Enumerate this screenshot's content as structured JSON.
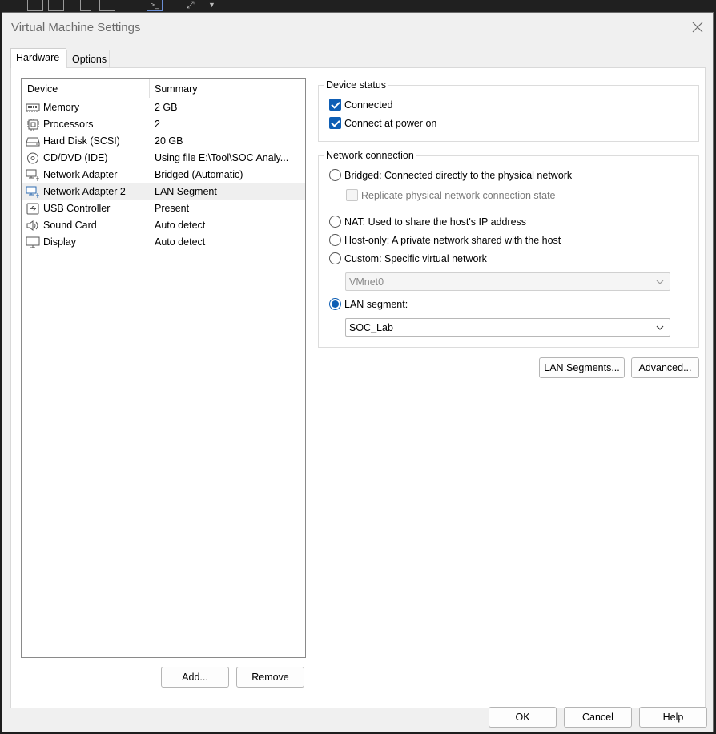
{
  "dialog": {
    "title": "Virtual Machine Settings"
  },
  "tabs": [
    {
      "label": "Hardware",
      "active": true
    },
    {
      "label": "Options",
      "active": false
    }
  ],
  "device_list": {
    "columns": [
      "Device",
      "Summary"
    ],
    "rows": [
      {
        "icon": "memory-icon",
        "name": "Memory",
        "summary": "2 GB"
      },
      {
        "icon": "processor-icon",
        "name": "Processors",
        "summary": "2"
      },
      {
        "icon": "hard-disk-icon",
        "name": "Hard Disk (SCSI)",
        "summary": "20 GB"
      },
      {
        "icon": "cd-dvd-icon",
        "name": "CD/DVD (IDE)",
        "summary": "Using file E:\\Tool\\SOC Analy..."
      },
      {
        "icon": "network-adapter-icon",
        "name": "Network Adapter",
        "summary": "Bridged (Automatic)"
      },
      {
        "icon": "network-adapter-icon",
        "name": "Network Adapter 2",
        "summary": "LAN Segment",
        "selected": true
      },
      {
        "icon": "usb-icon",
        "name": "USB Controller",
        "summary": "Present"
      },
      {
        "icon": "speaker-icon",
        "name": "Sound Card",
        "summary": "Auto detect"
      },
      {
        "icon": "monitor-icon",
        "name": "Display",
        "summary": "Auto detect"
      }
    ],
    "add_label": "Add...",
    "remove_label": "Remove"
  },
  "device_status": {
    "label": "Device status",
    "connected": {
      "label": "Connected",
      "checked": true
    },
    "connect_power_on": {
      "label": "Connect at power on",
      "checked": true
    }
  },
  "network_connection": {
    "label": "Network connection",
    "bridged": "Bridged: Connected directly to the physical network",
    "replicate": "Replicate physical network connection state",
    "nat": "NAT: Used to share the host's IP address",
    "host_only": "Host-only: A private network shared with the host",
    "custom": "Custom: Specific virtual network",
    "custom_value": "VMnet0",
    "lan_segment": "LAN segment:",
    "lan_value": "SOC_Lab",
    "selected": "lan_segment"
  },
  "buttons": {
    "lan_segments": "LAN Segments...",
    "advanced": "Advanced...",
    "ok": "OK",
    "cancel": "Cancel",
    "help": "Help"
  },
  "colors": {
    "accent": "#0f5fb5",
    "selected_row": "#efefef"
  }
}
